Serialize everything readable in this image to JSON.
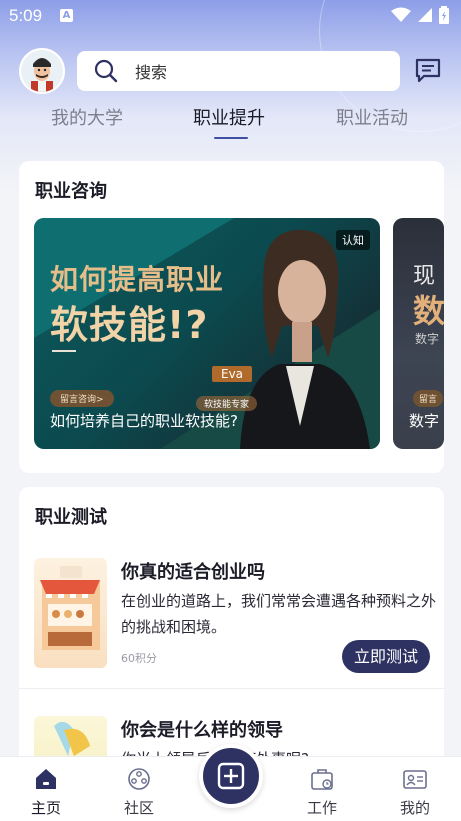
{
  "status_bar": {
    "time": "5:09",
    "notification_badge": "A"
  },
  "header": {
    "search_placeholder": "搜索",
    "avatar": "avatar-icon",
    "message_icon": "message-icon"
  },
  "tabs": [
    {
      "label": "我的大学",
      "active": false
    },
    {
      "label": "职业提升",
      "active": true
    },
    {
      "label": "职业活动",
      "active": false
    }
  ],
  "consult": {
    "title": "职业咨询",
    "banners": [
      {
        "headline_1": "如何提高职业",
        "headline_2": "软技能!?",
        "category": "认知",
        "expert_name": "Eva",
        "expert_role": "软技能专家",
        "consult_label": "留言咨询>",
        "caption": "如何培养自己的职业软技能?"
      },
      {
        "headline_1": "现",
        "headline_2": "数",
        "sub": "数字",
        "consult_label": "留言",
        "caption": "数字"
      }
    ]
  },
  "tests": {
    "title": "职业测试",
    "items": [
      {
        "title": "你真的适合创业吗",
        "desc": "在创业的道路上，我们常常会遭遇各种预料之外的挑战和困境。",
        "points": "60积分",
        "button": "立即测试"
      },
      {
        "title": "你会是什么样的领导",
        "desc": "你当上领导后会如何处事呢?"
      }
    ]
  },
  "bottom_nav": [
    {
      "label": "主页",
      "icon": "home-icon",
      "active": true
    },
    {
      "label": "社区",
      "icon": "community-icon",
      "active": false
    },
    {
      "label": "",
      "icon": "add-icon",
      "active": false
    },
    {
      "label": "工作",
      "icon": "briefcase-icon",
      "active": false
    },
    {
      "label": "我的",
      "icon": "profile-card-icon",
      "active": false
    }
  ],
  "colors": {
    "primary": "#2e3262",
    "accent_gold": "#e7bd8a",
    "header_gradient_top": "#8d9ee8"
  }
}
